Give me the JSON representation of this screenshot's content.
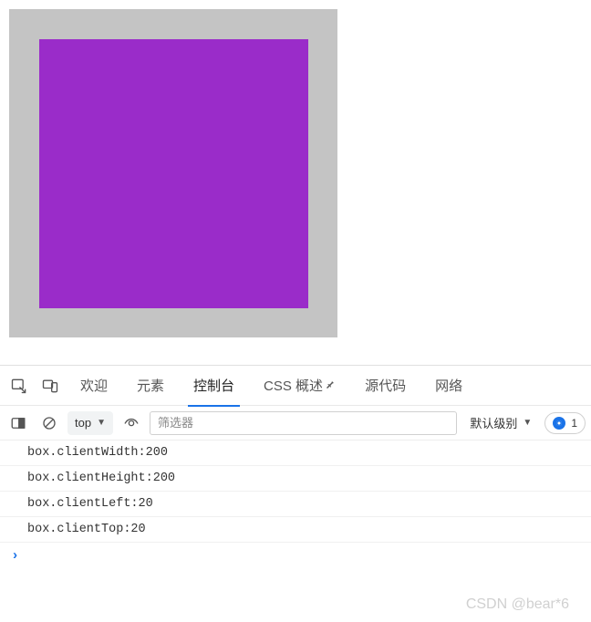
{
  "box": {
    "outer_bg": "#c4c4c4",
    "inner_bg": "#9a2cc9"
  },
  "tabs": {
    "welcome": "欢迎",
    "elements": "元素",
    "console": "控制台",
    "css_overview": "CSS 概述",
    "sources": "源代码",
    "network": "网络"
  },
  "toolbar": {
    "context": "top",
    "filter_placeholder": "筛选器",
    "level": "默认级别",
    "issue_count": "1"
  },
  "console": {
    "lines": [
      "box.clientWidth:200",
      "box.clientHeight:200",
      "box.clientLeft:20",
      "box.clientTop:20"
    ],
    "prompt": "›"
  },
  "watermark": "CSDN @bear*6"
}
